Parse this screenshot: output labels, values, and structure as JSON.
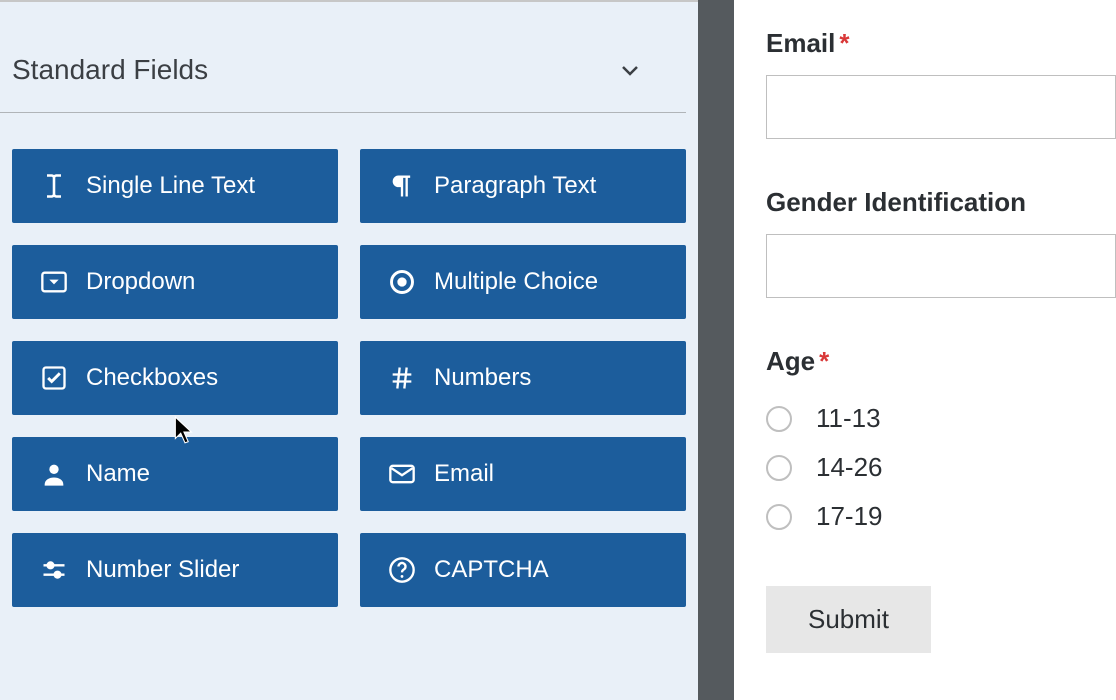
{
  "sidebar": {
    "section_title": "Standard Fields",
    "fields": [
      {
        "label": "Single Line Text",
        "icon": "text-cursor-icon"
      },
      {
        "label": "Paragraph Text",
        "icon": "paragraph-icon"
      },
      {
        "label": "Dropdown",
        "icon": "dropdown-icon"
      },
      {
        "label": "Multiple Choice",
        "icon": "radio-icon"
      },
      {
        "label": "Checkboxes",
        "icon": "checkbox-icon"
      },
      {
        "label": "Numbers",
        "icon": "hash-icon"
      },
      {
        "label": "Name",
        "icon": "person-icon"
      },
      {
        "label": "Email",
        "icon": "envelope-icon"
      },
      {
        "label": "Number Slider",
        "icon": "slider-icon"
      },
      {
        "label": "CAPTCHA",
        "icon": "question-icon"
      }
    ]
  },
  "form": {
    "email": {
      "label": "Email",
      "required": true,
      "value": ""
    },
    "gender": {
      "label": "Gender Identification",
      "required": false,
      "value": ""
    },
    "age": {
      "label": "Age",
      "required": true,
      "options": [
        "11-13",
        "14-26",
        "17-19"
      ]
    },
    "submit_label": "Submit"
  }
}
